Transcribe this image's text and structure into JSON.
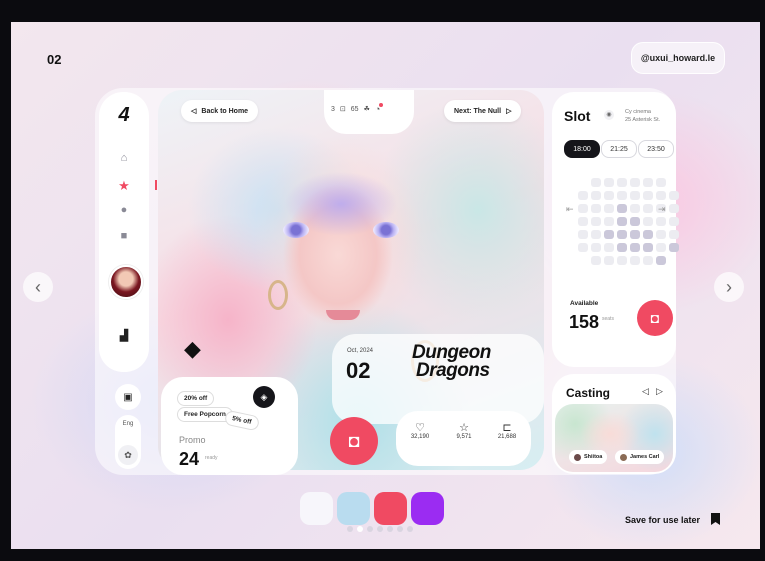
{
  "page": {
    "number": "02",
    "handle": "@uxui_howard.le"
  },
  "hero": {
    "back_label": "Back to Home",
    "next_label": "Next: The Null",
    "notch_count_a": "3",
    "notch_count_b": "65"
  },
  "sidebar": {
    "logo": "4",
    "lang_label": "Eng"
  },
  "slot": {
    "title": "Slot",
    "cinema_line1": "Cy cinema",
    "cinema_line2": "25 Asterisk St.",
    "times": [
      "18:00",
      "21:25",
      "23:50"
    ],
    "available_label": "Available",
    "available_count": "158",
    "available_unit": "seats"
  },
  "promo": {
    "tags": [
      "20% off",
      "Free Popcorn",
      "5% off"
    ],
    "label": "Promo",
    "count": "24",
    "unit": "ready"
  },
  "movie": {
    "date_label": "Oct, 2024",
    "day": "02",
    "title_line1": "Dungeon",
    "title_line2": "Dragons"
  },
  "stats": {
    "likes": "32,190",
    "stars": "9,571",
    "saves": "21,688"
  },
  "casting": {
    "title": "Casting",
    "cast": [
      "Shiitoa",
      "James Carl"
    ]
  },
  "footer": {
    "save_label": "Save for use later",
    "swatches": [
      "#f7f6fb",
      "#b9dcef",
      "#f04a62",
      "#9b2cf2"
    ]
  },
  "colors": {
    "accent": "#f04a62",
    "purple": "#9b2cf2"
  }
}
